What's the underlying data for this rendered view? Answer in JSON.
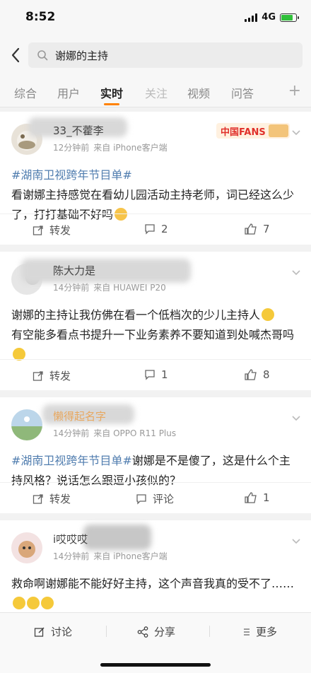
{
  "status_bar": {
    "time": "8:52",
    "network": "4G"
  },
  "search": {
    "query": "谢娜的主持"
  },
  "tabs": [
    {
      "label": "综合"
    },
    {
      "label": "用户"
    },
    {
      "label": "实时"
    },
    {
      "label": "关注"
    },
    {
      "label": "视频"
    },
    {
      "label": "问答"
    }
  ],
  "posts": [
    {
      "user": "33_不藿李",
      "time": "12分钟前",
      "source": "来自 iPhone客户端",
      "badge": "中国FANS",
      "tag": "#湖南卫视跨年节目单#",
      "text": "看谢娜主持感觉在看幼儿园活动主持老师，词已经这么少了，打打基础不好吗",
      "repost": "转发",
      "comments": "2",
      "likes": "7"
    },
    {
      "user": "陈大力是",
      "time": "14分钟前",
      "source": "来自 HUAWEI P20",
      "text": "谢娜的主持让我仿佛在看一个低档次的少儿主持人",
      "text2": "有空能多看点书提升一下业务素养不要知道到处喊杰哥吗",
      "repost": "转发",
      "comments": "1",
      "likes": "8"
    },
    {
      "user": "懒得起名字",
      "time": "14分钟前",
      "source": "来自 OPPO R11 Plus",
      "tag": "#湖南卫视跨年节目单#",
      "text": "谢娜是不是傻了，这是什么个主持风格？说话怎么跟逗小孩似的？",
      "repost": "转发",
      "comments": "评论",
      "likes": "1"
    },
    {
      "user": "i哎哎哎",
      "time": "14分钟前",
      "source": "来自 iPhone客户端",
      "text": "救命啊谢娜能不能好好主持，这个声音我真的受不了……"
    }
  ],
  "bottom_bar": {
    "discuss": "讨论",
    "share": "分享",
    "more": "更多"
  },
  "colors": {
    "accent": "#ff8200",
    "tag": "#507daf"
  }
}
